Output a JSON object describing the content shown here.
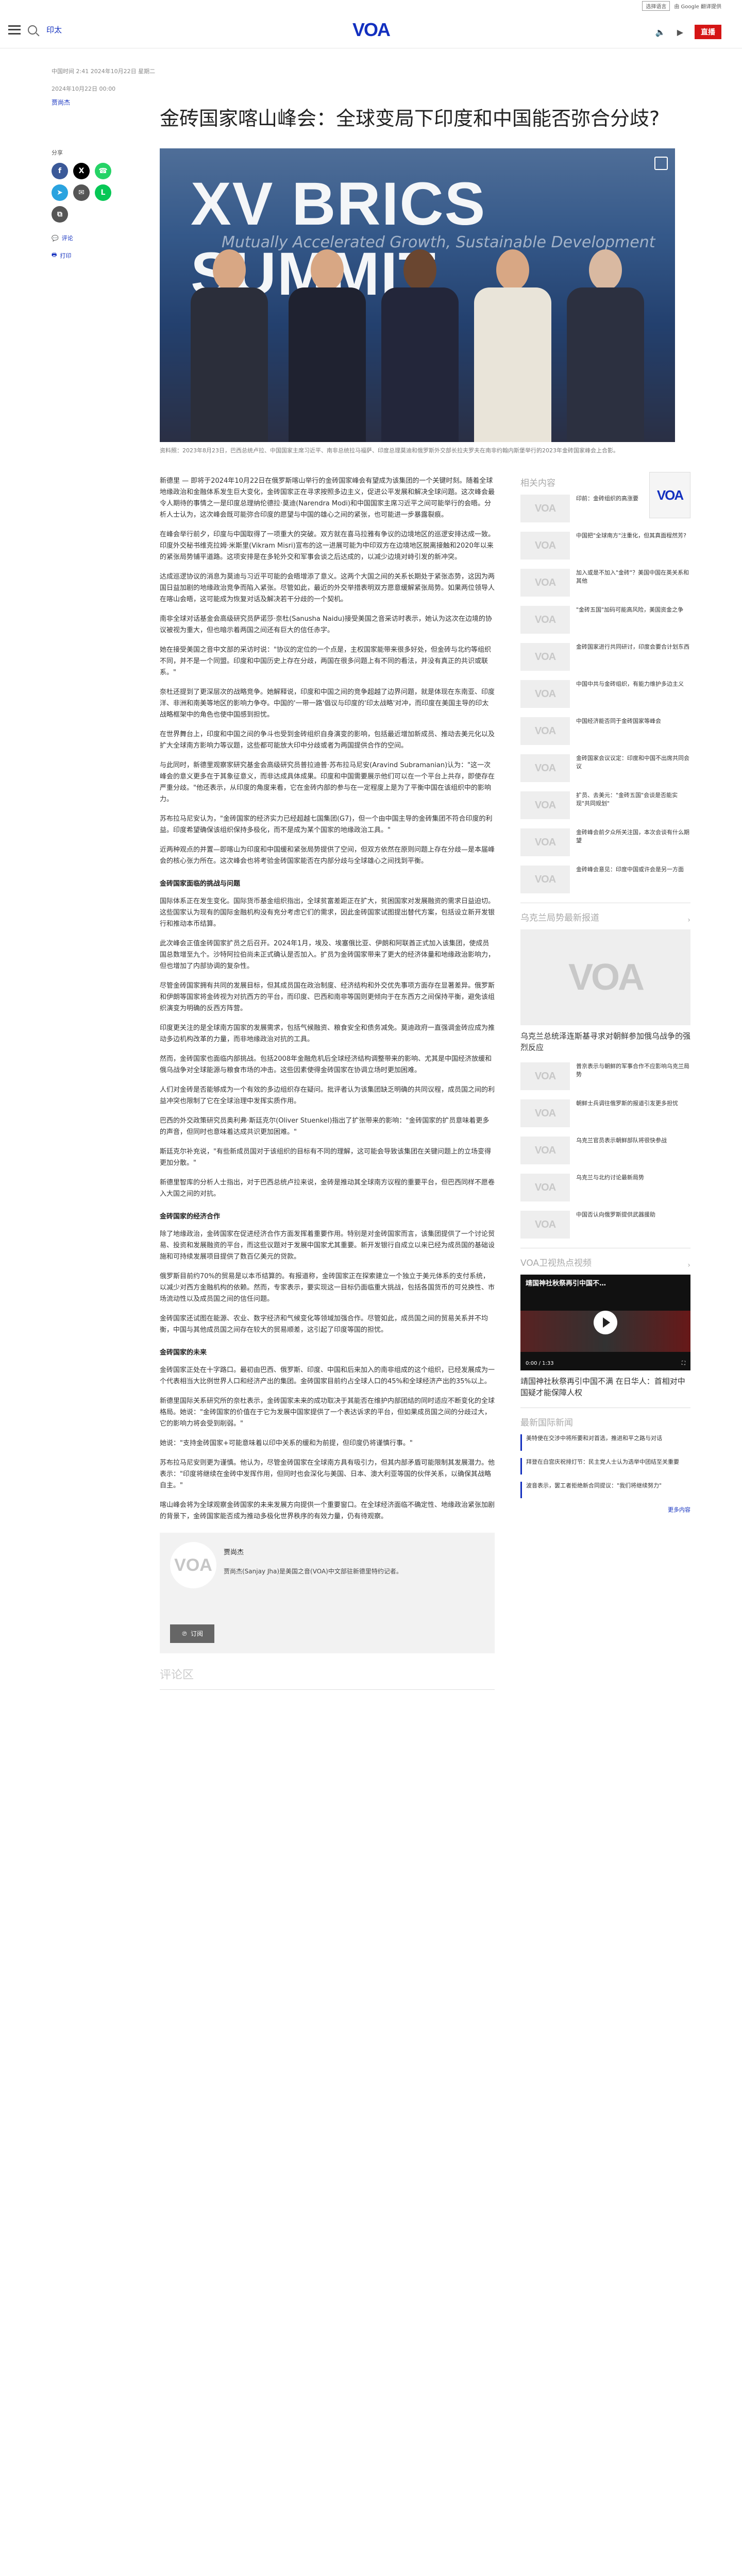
{
  "utility": {
    "language_select": "选择语言",
    "translate_label": "由 Google 翻译提供"
  },
  "header": {
    "nav_label": "印太",
    "logo_text": "VOA",
    "live_label": "直播"
  },
  "article": {
    "breadcrumb": "中国时间 2:41 2024年10月22日 星期二",
    "date": "2024年10月22日 00:00",
    "author": "贾尚杰",
    "title": "金砖国家喀山峰会：全球变局下印度和中国能否弥合分歧?",
    "hero_banner": "XV BRICS SUMMIT",
    "hero_sub": "Mutually Accelerated Growth, Sustainable Development",
    "caption": "资料照：2023年8月23日，巴西总统卢拉、中国国家主席习近平、南非总统拉马福萨、印度总理莫迪和俄罗斯外交部长拉夫罗夫在南非约翰内斯堡举行的2023年金砖国家峰会上合影。",
    "share_label": "分享",
    "comment_label": "评论",
    "print_label": "打印",
    "paragraphs": [
      "新德里 — 即将于2024年10月22日在俄罗斯喀山举行的金砖国家峰会有望成为该集团的一个关键时刻。随着全球地缘政治和金融体系发生巨大变化，金砖国家正在寻求按照多边主义，促进公平发展和解决全球问题。这次峰会最令人期待的事情之一是印度总理纳伦德拉·莫迪(Narendra Modi)和中国国家主席习近平之间可能举行的会晤。分析人士认为，这次峰会既可能弥合印度的愿望与中国的雄心之间的紧张，也可能进一步暴露裂痕。",
      "在峰会举行前夕，印度与中国取得了一项重大的突破。双方就在喜马拉雅有争议的边境地区的巡逻安排达成一致。印度外交秘书维克拉姆·米斯里(Vikram Misri)宣布的这一进展可能为中印双方在边境地区脱离接触和2020年以来的紧张局势铺平道路。这项安排是在多轮外交和军事会谈之后达成的，以减少边境对峙引发的新冲突。",
      "达成巡逻协议的消息为莫迪与习近平可能的会晤增添了意义。这两个大国之间的关系长期处于紧张态势，这因为两国日益加剧的地缘政治竞争而陷入紧张。尽管如此，最近的外交举措表明双方愿意缓解紧张局势。如果两位领导人在喀山会晤，这可能成为恢复对话及解决若干分歧的一个契机。",
      "南非全球对话基金会高级研究员萨诺莎·奈杜(Sanusha Naidu)接受美国之音采访时表示，她认为这次在边境的协议被视为重大，但也暗示着两国之间还有巨大的信任赤字。",
      "她在接受美国之音中文部的采访时说：\"协议的定位的一个点是，主权国家能带来很多好处，但金砖与北约等组织不同，并不是一个同盟。印度和中国历史上存在分歧，两国在很多问题上有不同的看法，并没有真正的共识或联系。\"",
      "奈杜还提到了更深层次的战略竞争。她解释说，印度和中国之间的竞争超越了边界问题，就是体现在东南亚、印度洋、非洲和南美等地区的影响力争夺。中国的'一带一路'倡议与印度的'印太战略'对冲，而印度在美国主导的印太战略框架中的角色也使中国感到担忧。",
      "在世界舞台上，印度和中国之间的争斗也受到金砖组织自身演变的影响，包括最近增加新成员、推动去美元化以及扩大全球南方影响力等议题，这些都可能放大印中分歧或者为两国提供合作的空间。",
      "与此同时，新德里观察家研究基金会高级研究员普拉迪普·苏布拉马尼安(Aravind Subramanian)认为：\"这一次峰会的意义更多在于其象征意义，而非达成具体成果。印度和中国需要展示他们可以在一个平台上共存，即使存在严重分歧。\"他还表示，从印度的角度来看，它在金砖内部的参与在一定程度上是为了平衡中国在该组织中的影响力。",
      "苏布拉马尼安认为，\"金砖国家的经济实力已经超越七国集团(G7)，但一个由中国主导的金砖集团不符合印度的利益。印度希望确保该组织保持多极化，而不是成为某个国家的地缘政治工具。\"",
      "近两种观点的并置—即喀山为印度和中国缓和紧张局势提供了空间，但双方依然在原则问题上存在分歧—是本届峰会的核心张力所在。这次峰会也将考验金砖国家能否在内部分歧与全球雄心之间找到平衡。"
    ],
    "h_challenges": "金砖国家面临的挑战与问题",
    "paragraphs2": [
      "国际体系正在发生变化。国际货币基金组织指出，全球贫富差距正在扩大，贫困国家对发展融资的需求日益迫切。这些国家认为现有的国际金融机构没有充分考虑它们的需求，因此金砖国家试图提出替代方案，包括设立新开发银行和推动本币结算。",
      "此次峰会正值金砖国家扩员之后召开。2024年1月，埃及、埃塞俄比亚、伊朗和阿联酋正式加入该集团，使成员国总数增至九个。沙特阿拉伯尚未正式确认是否加入。扩员为金砖国家带来了更大的经济体量和地缘政治影响力，但也增加了内部协调的复杂性。",
      "尽管金砖国家拥有共同的发展目标，但其成员国在政治制度、经济结构和外交优先事项方面存在显著差异。俄罗斯和伊朗等国家将金砖视为对抗西方的平台，而印度、巴西和南非等国则更倾向于在东西方之间保持平衡，避免该组织演变为明确的反西方阵营。",
      "印度更关注的是全球南方国家的发展需求，包括气候融资、粮食安全和债务减免。莫迪政府一直强调金砖应成为推动多边机构改革的力量，而非地缘政治对抗的工具。",
      "然而，金砖国家也面临内部挑战。包括2008年金融危机后全球经济结构调整带来的影响、尤其是中国经济放缓和俄乌战争对全球能源与粮食市场的冲击。这些因素使得金砖国家在协调立场时更加困难。",
      "人们对金砖是否能够成为一个有效的多边组织存在疑问。批评者认为该集团缺乏明确的共同议程，成员国之间的利益冲突也限制了它在全球治理中发挥实质作用。",
      "巴西的外交政策研究员奥利弗·斯廷克尔(Oliver Stuenkel)指出了扩张带来的影响：\"金砖国家的扩员意味着更多的声音，但同时也意味着达成共识更加困难。\"",
      "斯廷克尔补充说，\"有些新成员国对于该组织的目标有不同的理解，这可能会导致该集团在关键问题上的立场变得更加分散。\"",
      "新德里智库的分析人士指出，对于巴西总统卢拉来说，金砖是推动其全球南方议程的重要平台，但巴西同样不愿卷入大国之间的对抗。"
    ],
    "h_economy": "金砖国家的经济合作",
    "paragraphs3": [
      "除了地缘政治，金砖国家在促进经济合作方面发挥着重要作用。特别是对金砖国家而言，该集团提供了一个讨论贸易、投资和发展融资的平台，而这些议题对于发展中国家尤其重要。新开发银行自成立以来已经为成员国的基础设施和可持续发展项目提供了数百亿美元的贷款。",
      "俄罗斯目前约70%的贸易是以本币结算的。有报道称，金砖国家正在探索建立一个独立于美元体系的支付系统，以减少对西方金融机构的依赖。然而，专家表示，要实现这一目标仍面临重大挑战，包括各国货币的可兑换性、市场流动性以及成员国之间的信任问题。",
      "金砖国家还试图在能源、农业、数字经济和气候变化等领域加强合作。尽管如此，成员国之间的贸易关系并不均衡，中国与其他成员国之间存在较大的贸易顺差，这引起了印度等国的担忧。"
    ],
    "h_future": "金砖国家的未来",
    "paragraphs4": [
      "金砖国家正处在十字路口。最初由巴西、俄罗斯、印度、中国和后来加入的南非组成的这个组织，已经发展成为一个代表相当大比例世界人口和经济产出的集团。金砖国家目前约占全球人口的45%和全球经济产出的35%以上。",
      "新德里国际关系研究所的奈杜表示，金砖国家未来的成功取决于其能否在维护内部团结的同时适应不断变化的全球格局。她说：\"金砖国家的价值在于它为发展中国家提供了一个表达诉求的平台，但如果成员国之间的分歧过大，它的影响力将会受到削弱。\"",
      "她说：\"支持金砖国家+可能意味着以印中关系的缓和为前提，但印度仍将谨慎行事。\"",
      "苏布拉马尼安则更为谨慎。他认为，尽管金砖国家在全球南方具有吸引力，但其内部矛盾可能限制其发展潜力。他表示：\"印度将继续在金砖中发挥作用，但同时也会深化与美国、日本、澳大利亚等国的伙伴关系，以确保其战略自主。\"",
      "喀山峰会将为全球观察金砖国家的未来发展方向提供一个重要窗口。在全球经济面临不确定性、地缘政治紧张加剧的背景下，金砖国家能否成为推动多极化世界秩序的有效力量，仍有待观察。"
    ],
    "author_card": {
      "name": "贾尚杰",
      "bio": "贾尚杰(Sanjay Jha)是美国之音(VOA)中文部驻新德里特约记者。",
      "subscribe": "订阅"
    },
    "comments_title": "评论区"
  },
  "sidebar": {
    "related_title": "相关内容",
    "related": [
      "印前：金砖组织的高涨要",
      "中国把\"全球南方\"注重化，但其真面程然芳?",
      "加入或是不加入\"金砖\"？美国中国在英关系和其他",
      "\"金砖五国\"加码可能高风险，美国资金之争",
      "金砖国家进行共同研讨，印度会要合计划东西",
      "中国中共与金砖组织，有能力维护多边主义",
      "中国经济能否同于金砖国家等峰会",
      "金砖国家会议议定：印度和中国不出席共同会议",
      "扩员、去美元：\"金砖五国\"会谈是否能实现\"共同规划\"",
      "金砖峰会前夕众所关注国，本次会谈有什么期望",
      "金砖峰会意见：印度中国或许会是另一方面"
    ],
    "feature_title": "乌克兰局势最新报道",
    "feature_headline": "乌克兰总统泽连斯基寻求对朝鲜参加俄乌战争的强烈反应",
    "feature_items": [
      "普京表示与朝鲜的军事合作不应影响乌克兰局势",
      "朝鲜士兵调往俄罗斯的报道引发更多担忧",
      "乌克兰官员表示朝鲜部队将很快参战",
      "乌克兰与北约讨论最新局势",
      "中国否认向俄罗斯提供武器援助"
    ],
    "video_title": "VOA卫视热点视频",
    "video_overlay": "靖国神社秋祭再引中国不…",
    "video_time": "0:00 / 1:33",
    "video_caption": "靖国神社秋祭再引中国不满 在日华人：首相对中国疑才能保障人权",
    "news_title": "最新国际新闻",
    "news": [
      "美特使在交涉中将所要和对首选，推进和平之路与对话",
      "拜登在白宫庆祝排灯节：民主党人士认为选举中团结至关重要",
      "波音表示，罢工者拒绝新合同提议：\"我们将继续努力\""
    ],
    "more_label": "更多内容"
  }
}
